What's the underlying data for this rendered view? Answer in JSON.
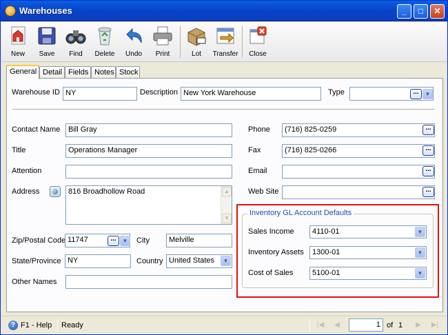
{
  "window": {
    "title": "Warehouses"
  },
  "title_buttons": {
    "minimize": "_",
    "maximize": "□",
    "close": "✕"
  },
  "toolbar": [
    {
      "name": "new",
      "label": "New"
    },
    {
      "name": "save",
      "label": "Save"
    },
    {
      "name": "find",
      "label": "Find"
    },
    {
      "name": "delete",
      "label": "Delete"
    },
    {
      "name": "undo",
      "label": "Undo"
    },
    {
      "name": "print",
      "label": "Print"
    },
    {
      "name": "lot",
      "label": "Lot"
    },
    {
      "name": "transfer",
      "label": "Transfer"
    },
    {
      "name": "close",
      "label": "Close"
    }
  ],
  "tabs": [
    "General",
    "Detail",
    "Fields",
    "Notes",
    "Stock"
  ],
  "active_tab": "General",
  "form": {
    "warehouse_id_label": "Warehouse ID",
    "warehouse_id": "NY",
    "description_label": "Description",
    "description": "New York Warehouse",
    "type_label": "Type",
    "type": "",
    "contact_name_label": "Contact Name",
    "contact_name": "Bill Gray",
    "title_label": "Title",
    "title": "Operations Manager",
    "attention_label": "Attention",
    "attention": "",
    "address_label": "Address",
    "address": "816 Broadhollow Road",
    "zip_label": "Zip/Postal Code",
    "zip": "11747",
    "city_label": "City",
    "city": "Melville",
    "state_label": "State/Province",
    "state": "NY",
    "country_label": "Country",
    "country": "United States",
    "other_names_label": "Other Names",
    "other_names": "",
    "phone_label": "Phone",
    "phone": "(716) 825-0259",
    "fax_label": "Fax",
    "fax": "(716) 825-0266",
    "email_label": "Email",
    "email": "",
    "website_label": "Web Site",
    "website": ""
  },
  "gl_defaults": {
    "title": "Inventory GL Account Defaults",
    "sales_income_label": "Sales Income",
    "sales_income": "4110-01",
    "inventory_assets_label": "Inventory Assets",
    "inventory_assets": "1300-01",
    "cost_of_sales_label": "Cost of Sales",
    "cost_of_sales": "5100-01"
  },
  "statusbar": {
    "help": "F1 - Help",
    "status": "Ready",
    "page": "1",
    "of_label": "of",
    "total": "1"
  },
  "colors": {
    "highlight": "#e01010",
    "titlebar": "#0a4fd4",
    "group_title": "#1a4fb4"
  }
}
